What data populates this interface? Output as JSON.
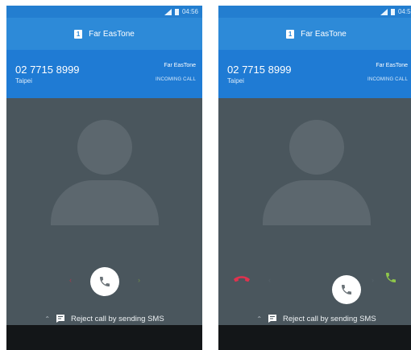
{
  "screens": [
    {
      "status": {
        "time": "04:56"
      },
      "carrier_bar": {
        "sim": "1",
        "name": "Far EasTone"
      },
      "call": {
        "number": "02 7715 8999",
        "location": "Taipei",
        "carrier": "Far EasTone",
        "status": "INCOMING CALL"
      },
      "sms_hint": {
        "label": "Reject call by sending SMS"
      }
    },
    {
      "status": {
        "time": "04:57"
      },
      "carrier_bar": {
        "sim": "1",
        "name": "Far EasTone"
      },
      "call": {
        "number": "02 7715 8999",
        "location": "Taipei",
        "carrier": "Far EasTone",
        "status": "INCOMING CALL"
      },
      "sms_hint": {
        "label": "Reject call by sending SMS"
      }
    }
  ],
  "icons": {
    "answer": "phone-icon",
    "decline": "phone-hang-up-icon",
    "accept": "phone-icon",
    "reply": "message-icon",
    "expand": "chevron-up-icon",
    "signal": "signal-icon",
    "battery": "battery-icon"
  },
  "colors": {
    "status_bar": "#237ed0",
    "carrier_bar": "#2d8ad8",
    "call_header": "#1f7bd4",
    "background": "#4a565d",
    "avatar": "#5c676e",
    "answer_icon": "#6b7378",
    "decline": "#e0324e",
    "accept": "#8fc74a",
    "nav_bar": "#131618"
  }
}
